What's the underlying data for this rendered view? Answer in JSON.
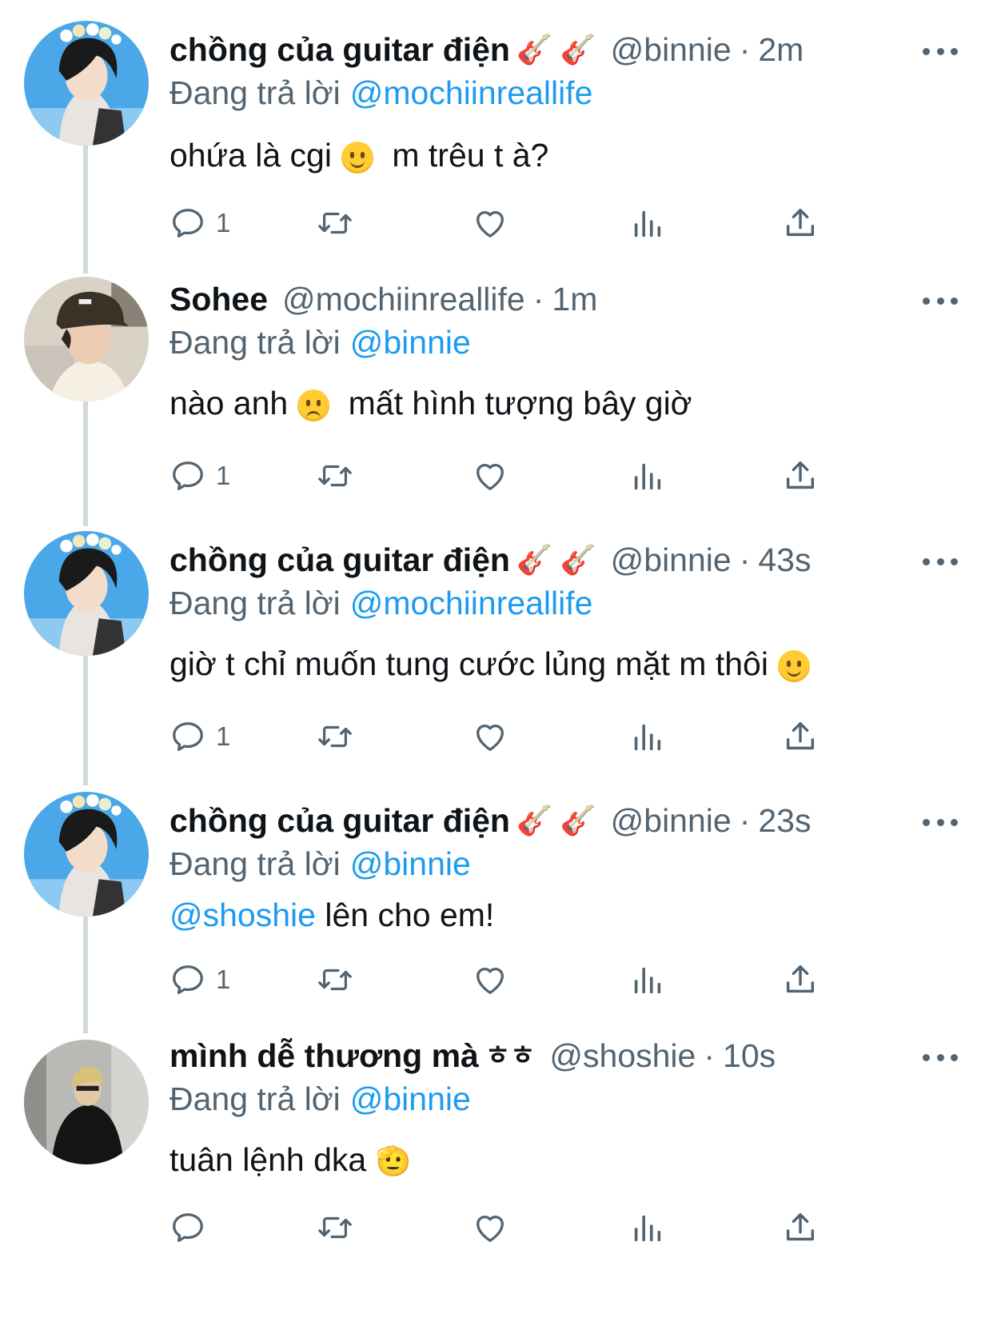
{
  "tweets": [
    {
      "display_name": "chồng của guitar điện",
      "name_emoji": "🎸 🎸",
      "handle": "@binnie",
      "separator": "·",
      "time": "2m",
      "reply_prefix": "Đang trả lời",
      "reply_to": "@mochiinreallife",
      "text_before": "ohứa là cgi",
      "text_after": "m trêu t à?",
      "mention_in_text": "",
      "reply_count": "1",
      "avatar_style": "flower-crown"
    },
    {
      "display_name": "Sohee",
      "name_emoji": "",
      "handle": "@mochiinreallife",
      "separator": "·",
      "time": "1m",
      "reply_prefix": "Đang trả lời",
      "reply_to": "@binnie",
      "text_before": "nào anh",
      "text_after": "mất hình tượng bây giờ",
      "mention_in_text": "",
      "reply_count": "1",
      "avatar_style": "cap"
    },
    {
      "display_name": "chồng của guitar điện",
      "name_emoji": "🎸 🎸",
      "handle": "@binnie",
      "separator": "·",
      "time": "43s",
      "reply_prefix": "Đang trả lời",
      "reply_to": "@mochiinreallife",
      "text_before": "giờ t chỉ muốn tung cước lủng mặt m thôi",
      "text_after": "",
      "mention_in_text": "",
      "reply_count": "1",
      "avatar_style": "flower-crown"
    },
    {
      "display_name": "chồng của guitar điện",
      "name_emoji": "🎸 🎸",
      "handle": "@binnie",
      "separator": "·",
      "time": "23s",
      "reply_prefix": "Đang trả lời",
      "reply_to": "@binnie",
      "text_before": "",
      "text_after": "lên cho em!",
      "mention_in_text": "@shoshie",
      "reply_count": "1",
      "avatar_style": "flower-crown"
    },
    {
      "display_name": "mình dễ thương mà",
      "name_emoji": "ㅎㅎ",
      "handle": "@shoshie",
      "separator": "·",
      "time": "10s",
      "reply_prefix": "Đang trả lời",
      "reply_to": "@binnie",
      "text_before": "tuân lệnh dka",
      "text_after": "🫡",
      "mention_in_text": "",
      "reply_count": "",
      "avatar_style": "dark-jacket"
    }
  ],
  "icons": {
    "reply": "reply-icon",
    "retweet": "retweet-icon",
    "like": "heart-icon",
    "views": "views-icon",
    "share": "share-icon",
    "more": "more-icon"
  },
  "colors": {
    "accent": "#1d9bf0",
    "secondary_text": "#536471",
    "thread_line": "#cfd9de"
  }
}
